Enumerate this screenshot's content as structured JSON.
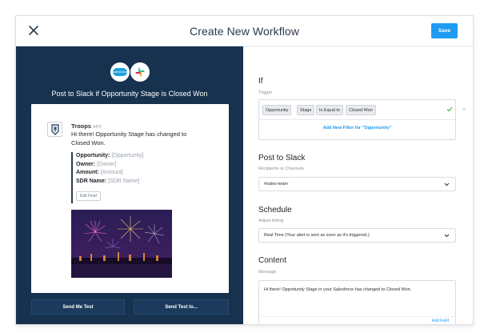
{
  "header": {
    "title": "Create New Workflow",
    "save_label": "Save"
  },
  "logos": {
    "salesforce_text": "salesforce"
  },
  "left": {
    "heading": "Post to Slack if Opportunity Stage is Closed Won",
    "message": {
      "app_name": "Troops",
      "app_tag": "APP",
      "text": "Hi there! Opportunity Stage has changed to Closed Won.",
      "fields": [
        {
          "label": "Opportunity:",
          "placeholder": "[Opportunity]"
        },
        {
          "label": "Owner:",
          "placeholder": "[Owner]"
        },
        {
          "label": "Amount:",
          "placeholder": "[Amount]"
        },
        {
          "label": "SDR Name:",
          "placeholder": "[SDR Name]"
        }
      ],
      "edit_field_label": "Edit Field"
    },
    "send_test_label": "Send Me Test",
    "send_test_to_label": "Send Test to..."
  },
  "right": {
    "if_section": {
      "title": "If",
      "subtitle": "Trigger",
      "chips": [
        "Opportunity",
        "Stage",
        "Is Equal to",
        "Closed Won"
      ],
      "add_filter_label": "Add New Filter for \"Opportunity\""
    },
    "post_section": {
      "title": "Post to Slack",
      "subtitle": "Recipients or Channels",
      "value": "#sales-team"
    },
    "schedule_section": {
      "title": "Schedule",
      "subtitle": "Adjust timing",
      "value": "Real Time (Your alert is sent as soon as it's triggered.)"
    },
    "content_section": {
      "title": "Content",
      "subtitle": "Message",
      "value": "Hi there! Opportunity Stage in your Salesforce has changed to Closed Won.",
      "add_field_label": "Add Field"
    }
  },
  "colors": {
    "accent": "#1e9bf0",
    "panel": "#16324f",
    "check": "#4caf50"
  }
}
